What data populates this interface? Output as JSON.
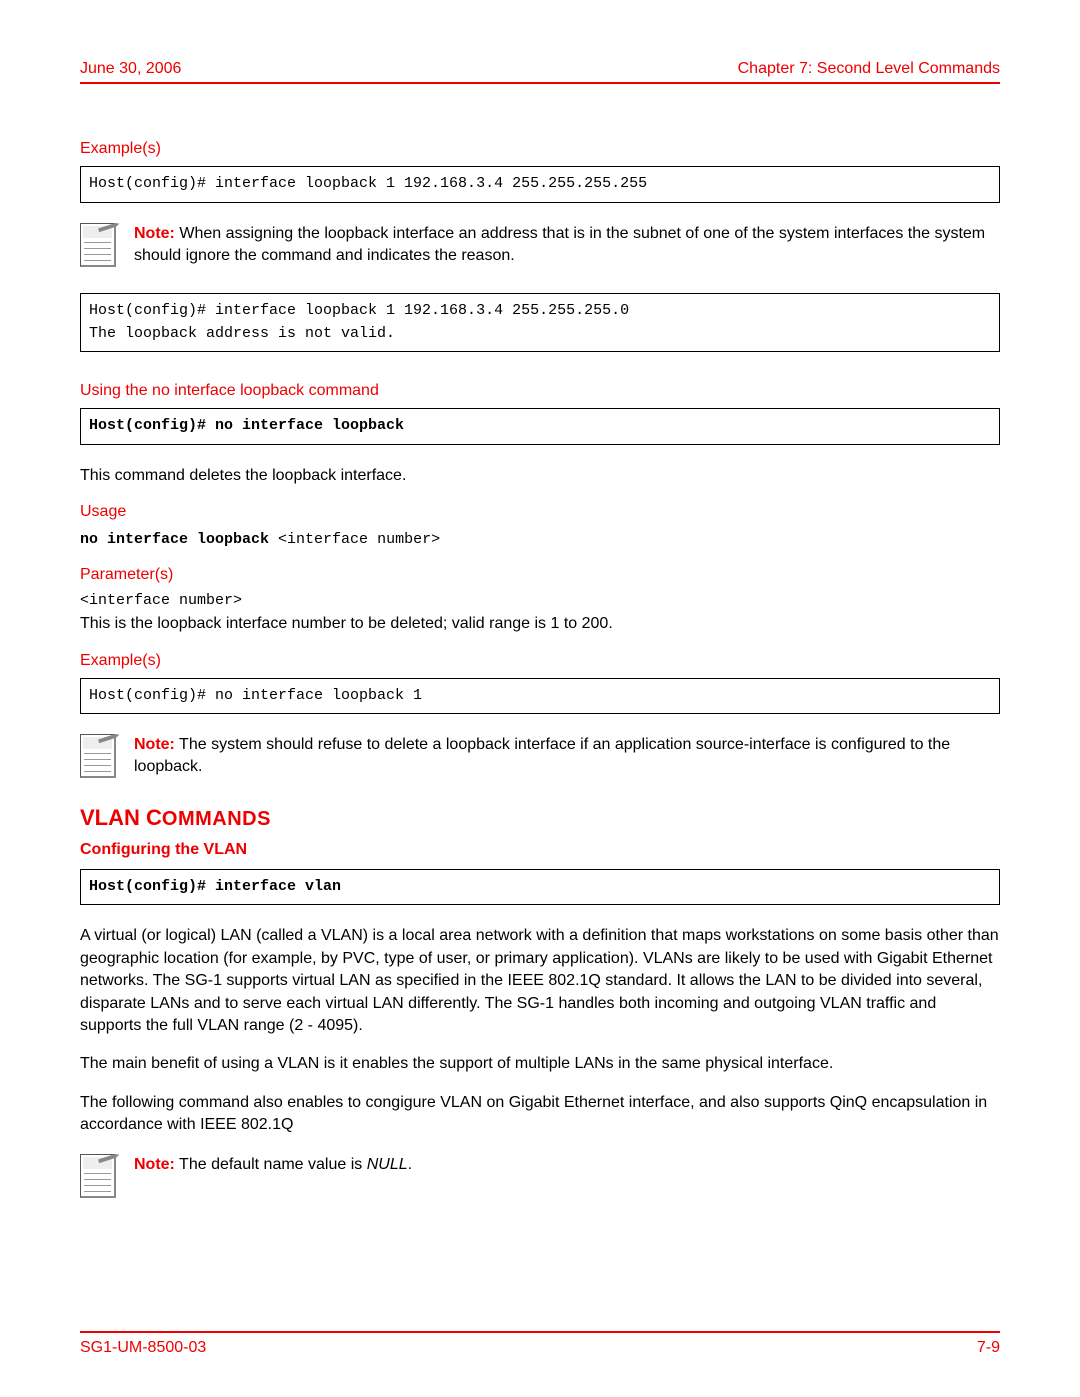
{
  "header": {
    "date": "June 30, 2006",
    "chapter": "Chapter 7: Second Level Commands"
  },
  "examples1": {
    "label": "Example(s)",
    "code": "Host(config)# interface loopback 1 192.168.3.4 255.255.255.255"
  },
  "note1": {
    "label": "Note:",
    "text": " When assigning the loopback interface an address that is in the subnet of one of the system interfaces the system should ignore the command and indicates the reason."
  },
  "code2": "Host(config)# interface loopback 1 192.168.3.4 255.255.255.0\nThe loopback address is not valid.",
  "no_interface": {
    "heading": "Using the no interface loopback command",
    "code": "Host(config)# no interface loopback",
    "desc": "This command deletes the loopback interface."
  },
  "usage": {
    "label": "Usage",
    "bold": "no interface loopback ",
    "rest": "<interface number>"
  },
  "params": {
    "label": "Parameter(s)",
    "name": "<interface number>",
    "desc": "This is the loopback interface number to be deleted; valid range is 1 to 200."
  },
  "examples2": {
    "label": "Example(s)",
    "code": "Host(config)# no interface loopback 1"
  },
  "note2": {
    "label": "Note:",
    "text": " The system should refuse to delete a loopback interface if an application source-interface is configured to the loopback."
  },
  "vlan": {
    "title1": "VLAN C",
    "title2": "OMMANDS",
    "sub": "Configuring the VLAN",
    "code": "Host(config)# interface vlan",
    "p1": "A virtual (or logical) LAN (called a VLAN) is a local area network with a definition that maps workstations on some basis other than geographic location (for example, by PVC, type of user, or primary application). VLANs are likely to be used with Gigabit Ethernet networks. The SG-1 supports virtual LAN as specified in the IEEE 802.1Q standard. It allows the LAN to be divided into several, disparate LANs and to serve each virtual LAN differently. The SG-1 handles both incoming and outgoing VLAN traffic and supports the full VLAN range (2 - 4095).",
    "p2": "The main benefit of using a VLAN is it enables the support of multiple LANs in the same physical interface.",
    "p3": "The following command also enables to congigure VLAN on Gigabit Ethernet interface, and also supports QinQ encapsulation in accordance with IEEE 802.1Q"
  },
  "note3": {
    "label": "Note:",
    "text_a": " The default name value is ",
    "text_b": "NULL",
    "text_c": "."
  },
  "footer": {
    "left": "SG1-UM-8500-03",
    "right": "7-9"
  }
}
